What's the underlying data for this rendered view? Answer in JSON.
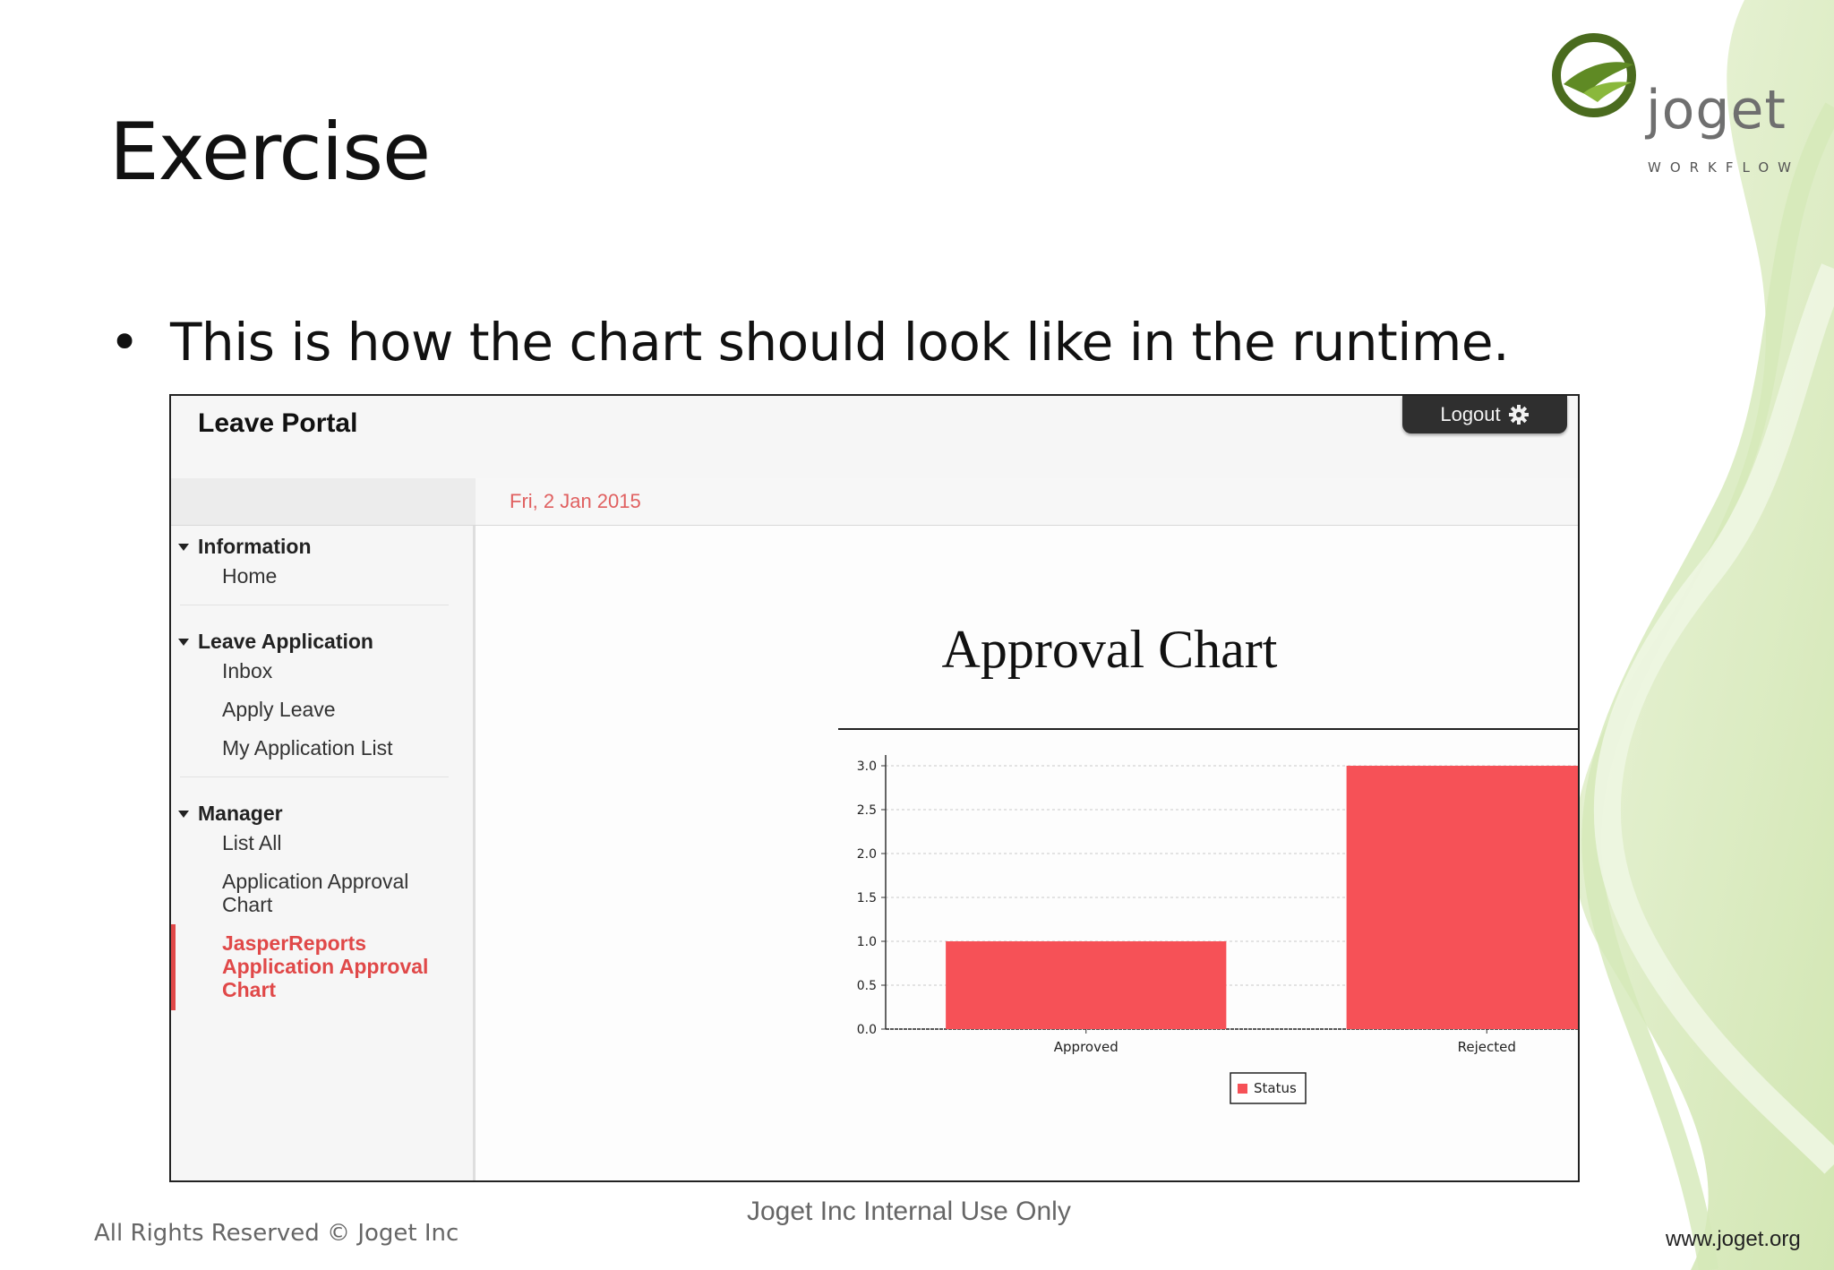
{
  "slide": {
    "title": "Exercise",
    "bullet_symbol": "•",
    "bullet_text": "This is how the chart should look like in the runtime.",
    "logo_word": "joget",
    "logo_sub": "WORKFLOW",
    "footer_left": "All Rights Reserved © Joget Inc",
    "footer_center": "Joget Inc Internal Use Only",
    "footer_right": "www.joget.org"
  },
  "app": {
    "title": "Leave Portal",
    "logout_label": "Logout",
    "date": "Fri, 2 Jan 2015",
    "sidebar": {
      "information": {
        "label": "Information",
        "items": [
          "Home"
        ]
      },
      "leave_application": {
        "label": "Leave Application",
        "items": [
          "Inbox",
          "Apply Leave",
          "My Application List"
        ]
      },
      "manager": {
        "label": "Manager",
        "items": [
          "List All",
          "Application Approval Chart",
          "JasperReports Application Approval Chart"
        ],
        "active_index": 2
      }
    }
  },
  "chart_data": {
    "type": "bar",
    "title": "Approval Chart",
    "categories": [
      "Approved",
      "Rejected"
    ],
    "series": [
      {
        "name": "Status",
        "values": [
          1,
          3
        ],
        "color": "#f65157"
      }
    ],
    "ylim": [
      0,
      3
    ],
    "yticks": [
      "0.0",
      "0.5",
      "1.0",
      "1.5",
      "2.0",
      "2.5",
      "3.0"
    ],
    "grid": true,
    "legend": "bottom-center"
  },
  "colors": {
    "accent_red": "#e04848",
    "bar": "#f65157",
    "logout_bg": "#2f2f2f"
  }
}
